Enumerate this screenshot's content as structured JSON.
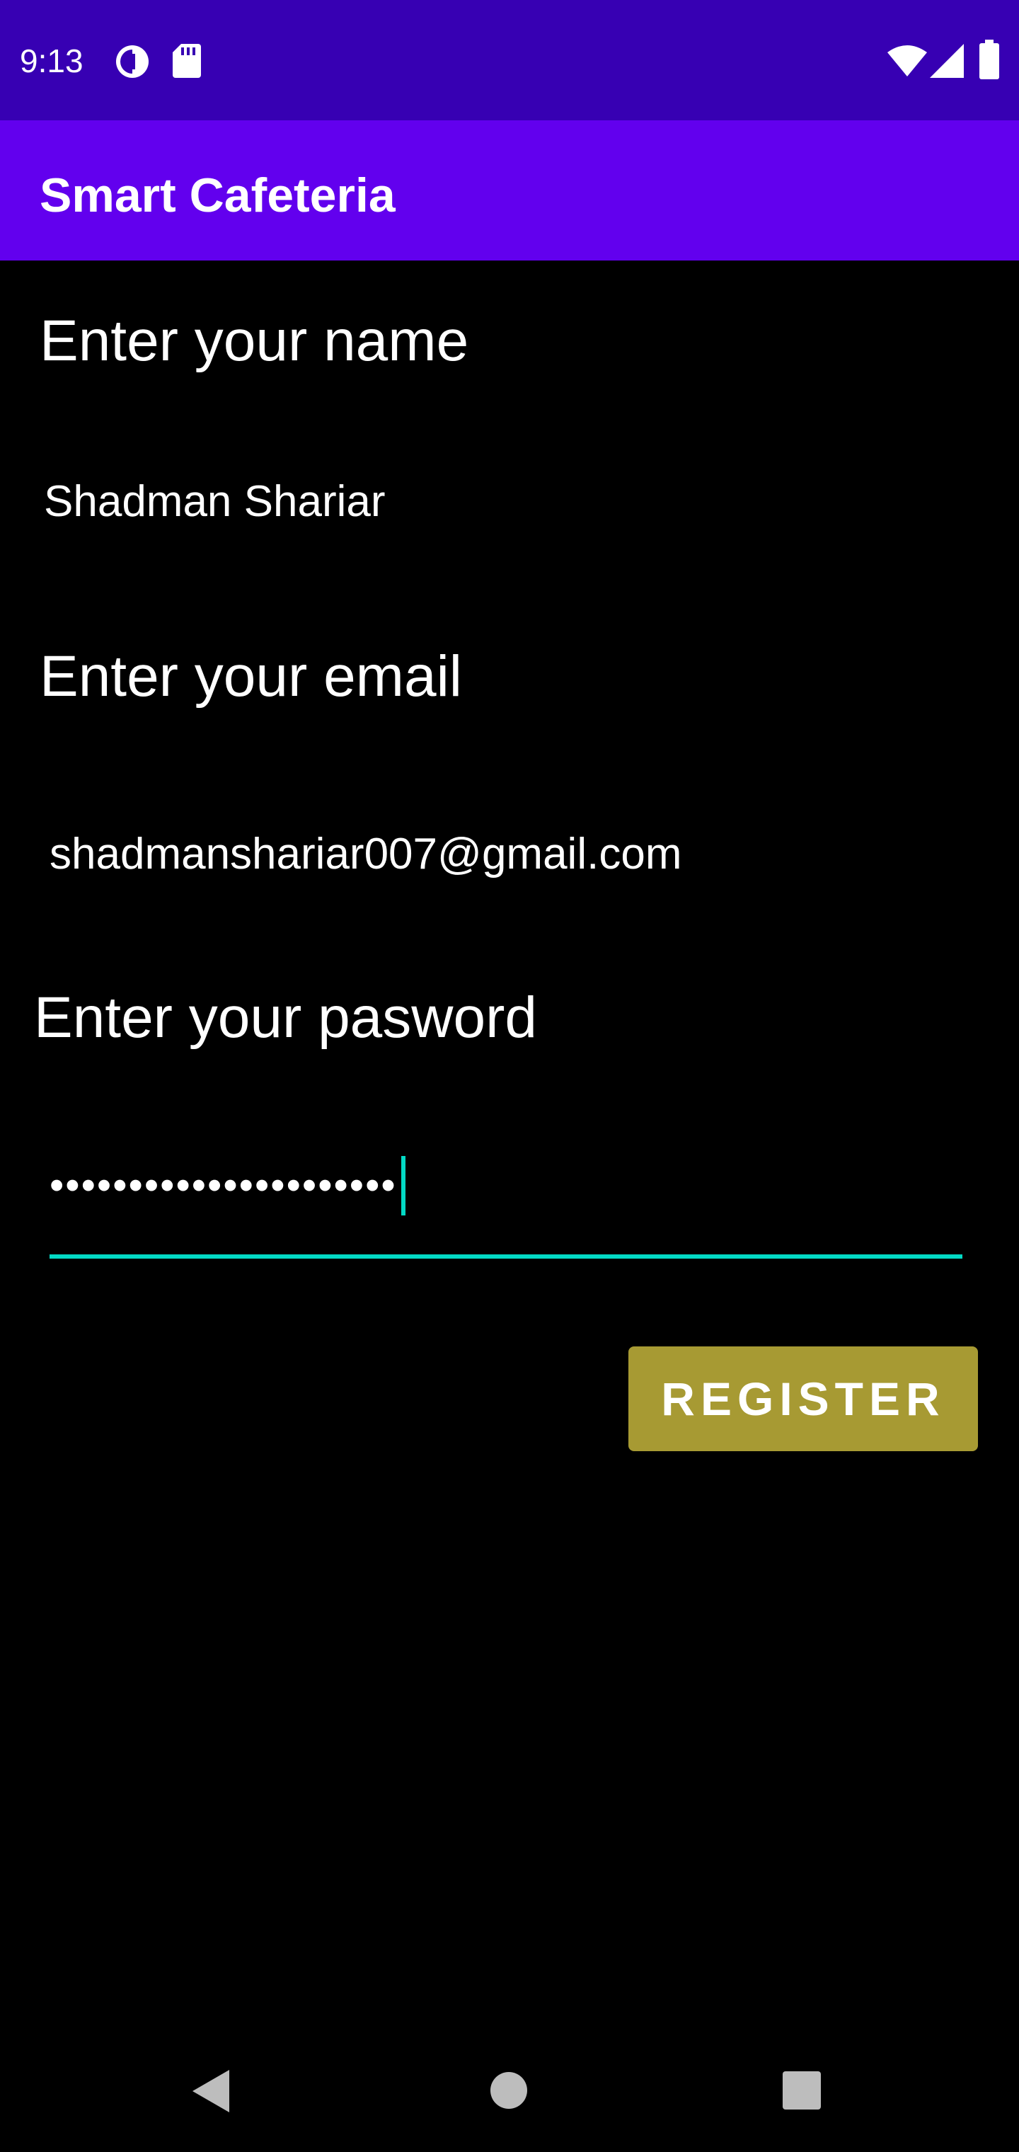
{
  "status_bar": {
    "time": "9:13",
    "icons": [
      "data-saver-icon",
      "sd-card-icon",
      "wifi-icon",
      "cellular-signal-icon",
      "battery-icon"
    ],
    "background_color": "#3700B3"
  },
  "app_bar": {
    "title": "Smart Cafeteria",
    "background_color": "#6200EE"
  },
  "form": {
    "name_label": "Enter your name",
    "name_value": "Shadman Shariar",
    "email_label": "Enter your email",
    "email_value": "shadmanshariar007@gmail.com",
    "password_label": "Enter your pasword",
    "password_value": "••••••••••••••••••••••",
    "focused_field": "password",
    "accent_color": "#03DAC5"
  },
  "register_button": {
    "label": "REGISTER",
    "background_color": "#A79A33"
  },
  "nav_bar": {
    "buttons": [
      "back-icon",
      "home-icon",
      "recents-icon"
    ]
  }
}
